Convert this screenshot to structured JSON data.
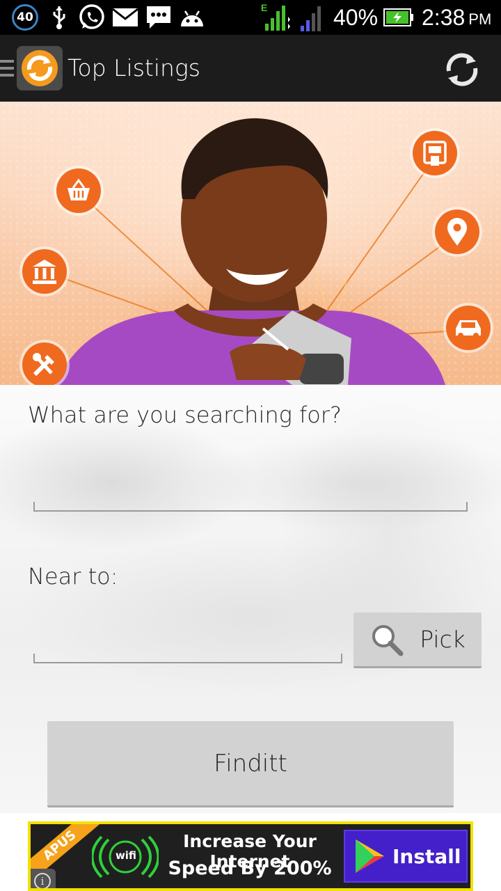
{
  "status_bar": {
    "notification_count": "40",
    "battery": "40%",
    "time": "2:38",
    "time_suffix": "PM",
    "network_type": "E",
    "icons": [
      "usb-icon",
      "whatsapp-icon",
      "gmail-icon",
      "message-icon",
      "android-icon",
      "signal-icon",
      "battery-icon"
    ]
  },
  "action_bar": {
    "title": "Top Listings",
    "icons": [
      "drawer-icon",
      "app-logo-icon",
      "refresh-icon"
    ]
  },
  "banner": {
    "icons": [
      "basket-icon",
      "bank-icon",
      "tools-icon",
      "atm-icon",
      "location-pin-icon",
      "car-icon"
    ]
  },
  "form": {
    "search_label": "What are you searching for?",
    "search_value": "",
    "near_label": "Near to:",
    "near_value": "",
    "pick_label": "Pick",
    "submit_label": "Finditt"
  },
  "ad": {
    "ribbon": "APUS",
    "wifi_label": "wifi",
    "line1": "Increase Your Internet",
    "line2": "Speed By 200%",
    "install_label": "Install",
    "info_label": "i"
  },
  "colors": {
    "status_bar": "#000000",
    "action_bar": "#1c1c1c",
    "accent_orange": "#ef6a1f",
    "button": "#d2d2d2",
    "ad_border": "#f2e100",
    "ad_install": "#4320c9"
  }
}
